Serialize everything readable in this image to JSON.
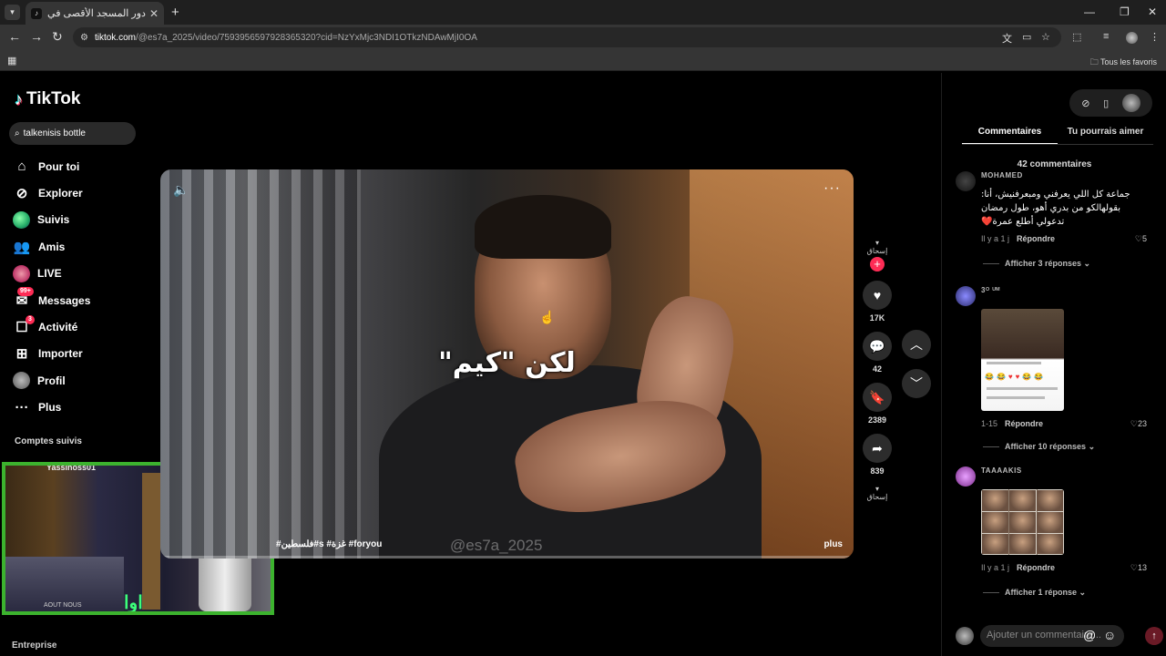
{
  "browser": {
    "tab_title": "دور المسجد الأقصى في الصراع ال...",
    "url_host": "tiktok.com",
    "url_path": "/@es7a_2025/video/7593956597928365320?cid=NzYxMjc3NDI1OTkzNDAwMjI0OA",
    "bookmarks_all": "Tous les favoris"
  },
  "sidebar": {
    "logo": "TikTok",
    "search_value": "talkenisis bottle",
    "items": [
      {
        "label": "Pour toi"
      },
      {
        "label": "Explorer"
      },
      {
        "label": "Suivis"
      },
      {
        "label": "Amis"
      },
      {
        "label": "LIVE"
      },
      {
        "label": "Messages",
        "badge": "99+"
      },
      {
        "label": "Activité",
        "badge": "3"
      },
      {
        "label": "Importer"
      },
      {
        "label": "Profil"
      },
      {
        "label": "Plus"
      }
    ],
    "following_heading": "Comptes suivis",
    "following_peek": "Yassinoss01",
    "footer": "Entreprise"
  },
  "webcam": {
    "overlay_text": "AOUT NOUS",
    "logo_text": "اوا"
  },
  "video": {
    "caption": "لكن \"كيم\"",
    "hashtags": "#فلسطين#s #غزة #foryou",
    "watermark": "@es7a_2025",
    "more_label": "plus"
  },
  "actions": {
    "likes": "17K",
    "comments": "42",
    "saves": "2389",
    "shares": "839"
  },
  "panel": {
    "tabs": [
      "Commentaires",
      "Tu pourrais aimer"
    ],
    "comment_count": "42 commentaires",
    "comments": [
      {
        "user": "MOHAMED",
        "text": "جماعة كل اللي يعرفني ومبعرفنيش، أنا: بقولهالكو من بدري أهو، طول رمضان تدعولي أطلع عمرة❤️",
        "time": "Il y a 1 j",
        "reply_label": "Répondre",
        "likes": "5",
        "replies": "Afficher 3 réponses"
      },
      {
        "user": "3ᴼ ᵁᴹ",
        "text": "",
        "time": "1-15",
        "reply_label": "Répondre",
        "likes": "23",
        "replies": "Afficher 10 réponses"
      },
      {
        "user": "TAAAAKIS",
        "text": "",
        "time": "Il y a 1 j",
        "reply_label": "Répondre",
        "likes": "13",
        "replies": "Afficher 1 réponse"
      }
    ],
    "input_placeholder": "Ajouter un commentaire..."
  }
}
